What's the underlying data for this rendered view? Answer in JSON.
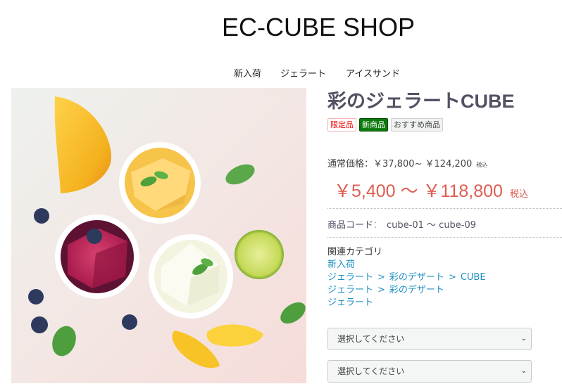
{
  "header": {
    "shop_title": "EC-CUBE SHOP",
    "nav": [
      {
        "label": "新入荷"
      },
      {
        "label": "ジェラート"
      },
      {
        "label": "アイスサンド"
      }
    ]
  },
  "product": {
    "image_alt": "ジェラート写真",
    "name": "彩のジェラートCUBE",
    "tags": [
      {
        "label": "限定品",
        "style": "limited"
      },
      {
        "label": "新商品",
        "style": "new"
      },
      {
        "label": "おすすめ商品",
        "style": "recommend"
      }
    ],
    "normal_price": {
      "label": "通常価格：",
      "value": "￥37,800~ ￥124,200",
      "tax": "税込"
    },
    "sale_price": {
      "value": "￥5,400 ～ ￥118,800",
      "tax": "税込"
    },
    "code": {
      "label": "商品コード",
      "separator": "：",
      "value": "cube-01 ～ cube-09"
    },
    "categories": {
      "heading": "関連カテゴリ",
      "separator": ">",
      "rows": [
        [
          "新入荷"
        ],
        [
          "ジェラート",
          "彩のデザート",
          "CUBE"
        ],
        [
          "ジェラート",
          "彩のデザート"
        ],
        [
          "ジェラート"
        ]
      ]
    },
    "selects": [
      {
        "value": "選択してください"
      },
      {
        "value": "選択してください"
      }
    ]
  },
  "colors": {
    "sale_price": "#de5d50",
    "link": "#1e8fc4",
    "tag_new_bg": "#0a7a0a",
    "tag_limited_text": "#ee0000"
  }
}
